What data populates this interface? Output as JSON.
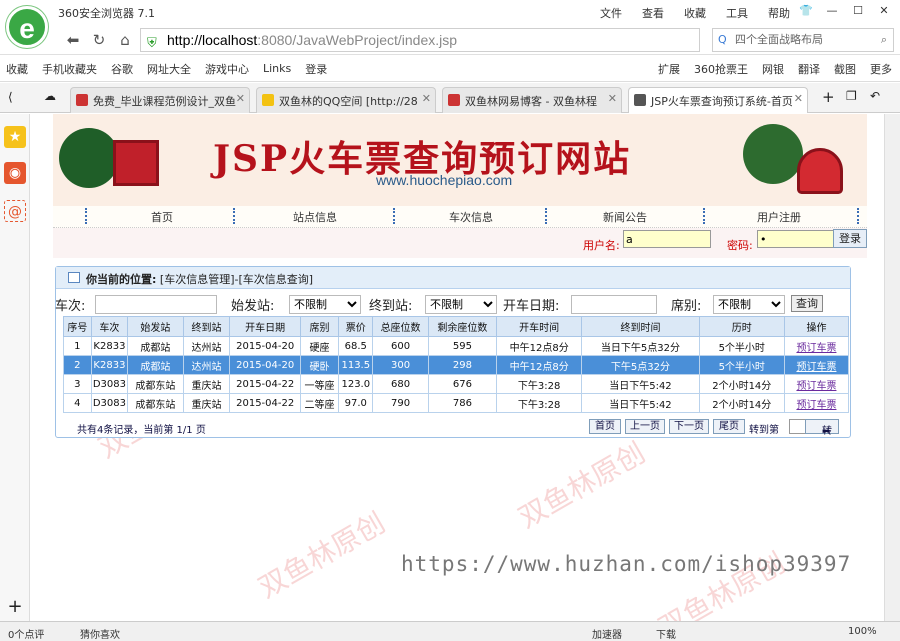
{
  "browser": {
    "title": "360安全浏览器 7.1",
    "logo_letter": "e",
    "top_menu": [
      "文件",
      "查看",
      "收藏",
      "工具",
      "帮助"
    ],
    "url_host": "http://localhost",
    "url_rest": ":8080/JavaWebProject/index.jsp",
    "search_placeholder": "四个全面战略布局",
    "bookmarks": [
      "收藏",
      "手机收藏夹",
      "谷歌",
      "网址大全",
      "游戏中心",
      "Links",
      "登录"
    ],
    "bookmarks_right": [
      "扩展",
      "360抢票王",
      "网银",
      "翻译",
      "截图",
      "更多"
    ],
    "tabs": [
      {
        "label": "免费_毕业课程范例设计_双鱼"
      },
      {
        "label": "双鱼林的QQ空间 [http://28"
      },
      {
        "label": "双鱼林网易博客 - 双鱼林程"
      },
      {
        "label": "JSP火车票查询预订系统-首页"
      }
    ],
    "status": {
      "comments": "0个点评",
      "guess": "猜你喜欢",
      "accel": "加速器",
      "download": "下载",
      "zoom": "100%"
    }
  },
  "site": {
    "title": "JSP火车票查询预订网站",
    "url": "www.huochepiao.com",
    "nav": [
      "首页",
      "站点信息",
      "车次信息",
      "新闻公告",
      "用户注册"
    ],
    "login": {
      "user_label": "用户名:",
      "user_value": "a",
      "pass_label": "密码:",
      "pass_value": "•",
      "button": "登录"
    }
  },
  "panel": {
    "location_label": "你当前的位置:",
    "location_path": "[车次信息管理]-[车次信息查询]"
  },
  "filters": {
    "train_label": "车次:",
    "from_label": "始发站:",
    "from_value": "不限制",
    "to_label": "终到站:",
    "to_value": "不限制",
    "date_label": "开车日期:",
    "seat_label": "席别:",
    "seat_value": "不限制",
    "query_button": "查询"
  },
  "table": {
    "headers": [
      "序号",
      "车次",
      "始发站",
      "终到站",
      "开车日期",
      "席别",
      "票价",
      "总座位数",
      "剩余座位数",
      "开车时间",
      "终到时间",
      "历时",
      "操作"
    ],
    "rows": [
      [
        "1",
        "K2833",
        "成都站",
        "达州站",
        "2015-04-20",
        "硬座",
        "68.5",
        "600",
        "595",
        "中午12点8分",
        "当日下午5点32分",
        "5个半小时",
        "预订车票"
      ],
      [
        "2",
        "K2833",
        "成都站",
        "达州站",
        "2015-04-20",
        "硬卧",
        "113.5",
        "300",
        "298",
        "中午12点8分",
        "下午5点32分",
        "5个半小时",
        "预订车票"
      ],
      [
        "3",
        "D3083",
        "成都东站",
        "重庆站",
        "2015-04-22",
        "一等座",
        "123.0",
        "680",
        "676",
        "下午3:28",
        "当日下午5:42",
        "2个小时14分",
        "预订车票"
      ],
      [
        "4",
        "D3083",
        "成都东站",
        "重庆站",
        "2015-04-22",
        "二等座",
        "97.0",
        "790",
        "786",
        "下午3:28",
        "当日下午5:42",
        "2个小时14分",
        "预订车票"
      ]
    ],
    "selected_row": 1
  },
  "pager": {
    "summary": "共有4条记录，当前第 1/1 页",
    "first": "首页",
    "prev": "上一页",
    "next": "下一页",
    "last": "尾页",
    "goto_label": "转到第",
    "page_unit": "页",
    "go": "转"
  },
  "watermark": {
    "text": "https://www.huzhan.com/ishop39397",
    "stamp": "双鱼林原创"
  }
}
